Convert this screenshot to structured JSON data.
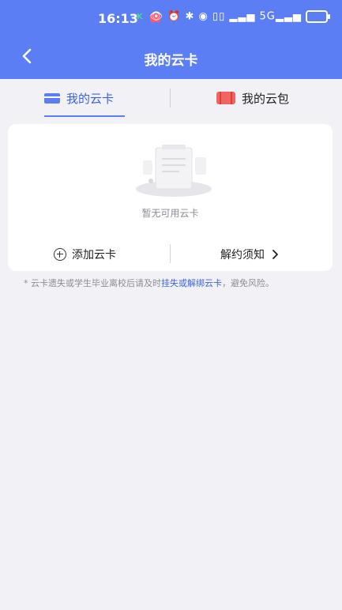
{
  "status_bar": {
    "time": "16:13",
    "app_badge": "K",
    "right_indicators": "👁 ⏰ ✱ ◉ ▯▯ ▂▃▅ 5G▂▃▅"
  },
  "nav": {
    "title": "我的云卡"
  },
  "tabs": [
    {
      "label": "我的云卡",
      "icon": "card-icon",
      "active": true
    },
    {
      "label": "我的云包",
      "icon": "wallet-icon",
      "active": false
    }
  ],
  "empty_state": {
    "text": "暂无可用云卡"
  },
  "actions": {
    "add_card": "添加云卡",
    "unbind_notice": "解约须知"
  },
  "note": {
    "prefix": "* 云卡遗失或学生毕业离校后请及时",
    "link": "挂失或解绑云卡",
    "suffix": "，避免风险。"
  },
  "colors": {
    "primary": "#5b7ef5",
    "link": "#3d63e0",
    "wallet": "#f06461",
    "background": "#f2f2f6"
  }
}
